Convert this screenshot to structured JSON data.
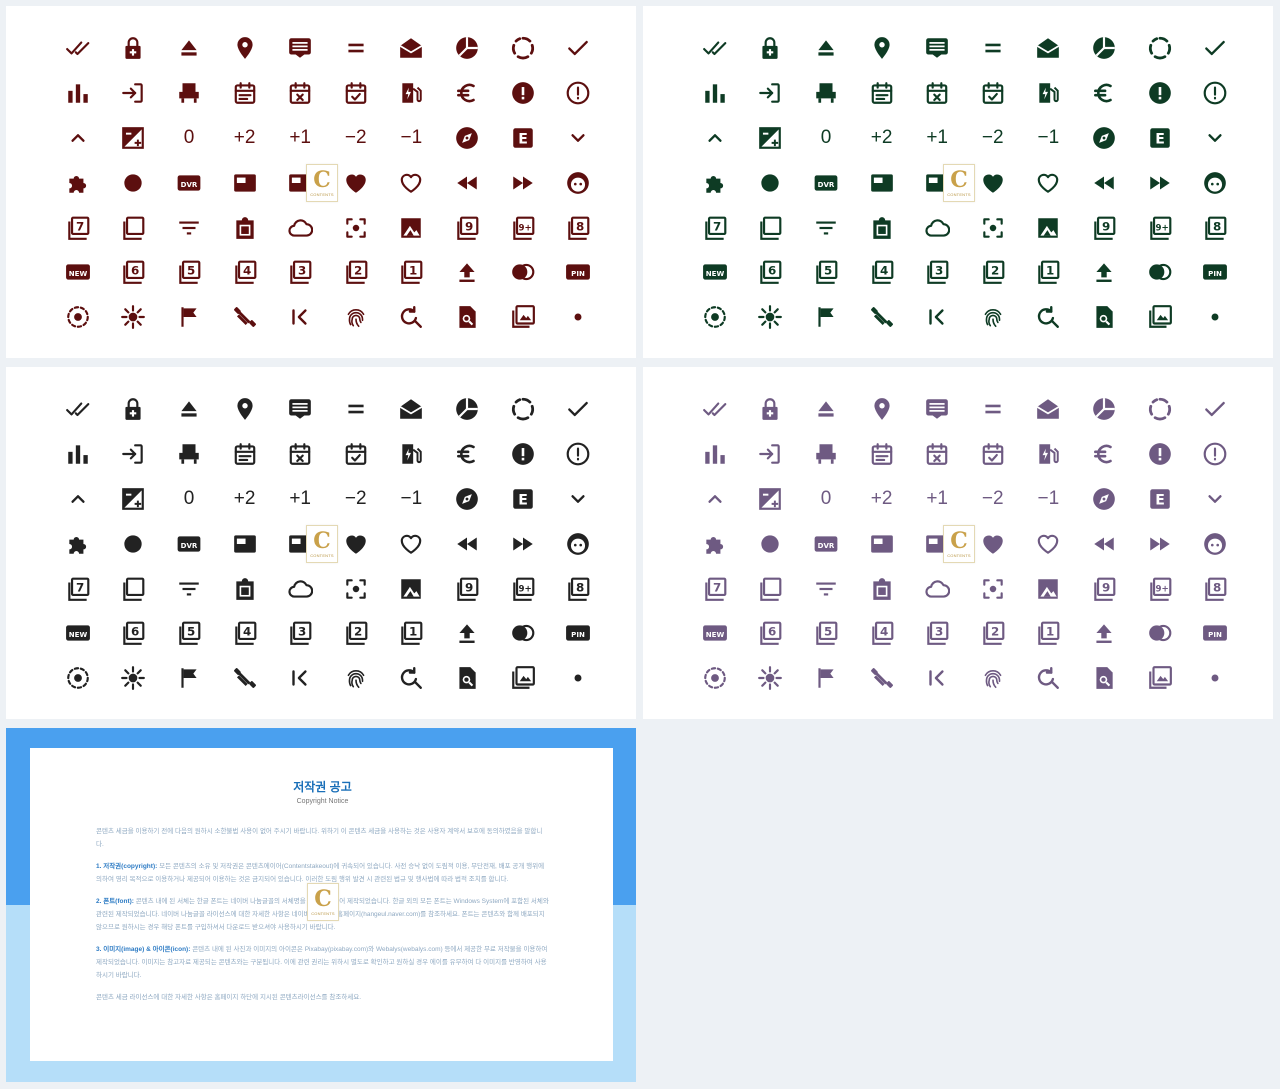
{
  "panels": [
    {
      "id": "red",
      "color": "#5c0f0f"
    },
    {
      "id": "green",
      "color": "#0e3b24"
    },
    {
      "id": "black",
      "color": "#222222"
    },
    {
      "id": "purple",
      "color": "#6e5a82"
    }
  ],
  "icons": [
    [
      "double-check",
      "lock-plus",
      "eject",
      "map-pin",
      "message-list",
      "equals",
      "envelope-open",
      "pie-chart",
      "circle-dashed",
      "check"
    ],
    [
      "bar-chart",
      "login",
      "car-seat",
      "calendar-text",
      "calendar-remove",
      "calendar-check",
      "fuel-station",
      "euro",
      "alert-circle-filled",
      "alert-circle-outline"
    ],
    [
      "chevron-up",
      "exposure",
      "0",
      "+2",
      "+1",
      "−2",
      "−1",
      "compass",
      "letter-e-box",
      "chevron-down"
    ],
    [
      "puzzle",
      "dot-large",
      "dvr",
      "card-inverted",
      "card-chip",
      "heart",
      "heart-outline",
      "rewind",
      "fast-forward",
      "face"
    ],
    [
      "filter-7",
      "square-outline",
      "filter-list",
      "clipboard",
      "cloud-outline",
      "center-focus",
      "image-filter",
      "filter-9",
      "filter-9-plus",
      "filter-8"
    ],
    [
      "new-badge",
      "filter-6",
      "filter-5",
      "filter-4",
      "filter-3",
      "filter-2",
      "filter-1",
      "upload",
      "toggle-switch",
      "pin-badge"
    ],
    [
      "radio-dashed",
      "brightness",
      "flag",
      "dumbbell",
      "skip-previous",
      "fingerprint",
      "find-replace",
      "file-search",
      "image-multiple",
      "dot-small"
    ]
  ],
  "labels": {
    "dvr": "DVR",
    "pin": "PIN",
    "new": "NEW",
    "e": "E",
    "f1": "1",
    "f2": "2",
    "f3": "3",
    "f4": "4",
    "f5": "5",
    "f6": "6",
    "f7": "7",
    "f8": "8",
    "f9": "9",
    "f9p": "9+"
  },
  "watermark": {
    "letter": "C",
    "tag": "CONTENTS"
  },
  "notice": {
    "title": "저작권 공고",
    "subtitle": "Copyright Notice",
    "intro": "콘텐츠 세금을 이용하기 전에 다음의 원하시 소한불법 사용이 없어 주시기 바랍니다. 위하기 이 콘텐츠 세금을 사용하는 것은 사용자 계약서 보호에 동의하였음을 말합니다.",
    "sections": [
      {
        "head": "1. 저작권(copyright):",
        "body": "모든 콘텐츠의 소유 및 저작권은 콘텐츠에이어(Contentstakeout)에 귀속되어 있습니다. 사전 승낙 없이 도림적 이용, 무단전재, 배포 공개 행위에 의하여 영리 목적으로 이용하거나 제공되어 이용하는 것은 금지되어 있습니다. 이러한 도림 행위 발견 시 관련된 법규 및 행사법에 따라 법적 조치를 합니다."
      },
      {
        "head": "2. 폰트(font):",
        "body": "콘텐츠 내에 된 서체는 한글 폰트는 네이버 나눔글꼴의 서체명을 모두 기록되어 제작되었습니다. 한글 외의 모든 폰트는 Windows System에 포함된 서체와 관련된 제작되었습니다. 네이버 나눔글꼴 라이선스에 대한 자세한 사항은 네이버 나눔글꼴 홈페이지(hangeul.naver.com)를 참조하세요. 폰트는 콘텐츠와 함께 배포되지 않으므로 원하시는 경우 해당 폰트를 구입하셔서 다운로드 받으셔야 사용하시기 바랍니다."
      },
      {
        "head": "3. 이미지(image) & 아이콘(icon):",
        "body": "콘텐츠 내에 된 사진과 이미지의 아이콘은 Pixabay(pixabay.com)와 Webalys(webalys.com) 등에서 제공한 무료 저작물을 이용하여 제작되었습니다. 이미지는 참고자료 제공되는 콘텐츠와는 구분됩니다. 이에 관련 권리는 위하시 별도로 확인하고 원하실 경우 에이를 유무하여 다 이미지를 반영하여 사용하시기 바랍니다."
      }
    ],
    "outro": "콘텐츠 세금 라이선스에 대한 자세한 사항은 홈페이지 하단에 지시된 콘텐츠라이선스를 참조하세요."
  }
}
